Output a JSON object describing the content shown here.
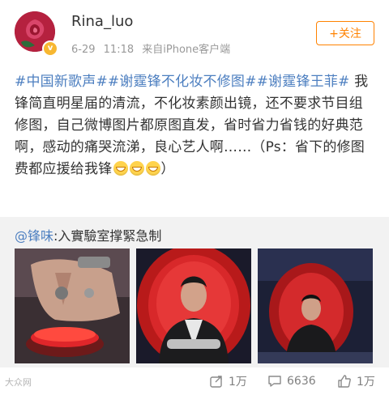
{
  "post": {
    "username": "Rina_luo",
    "date": "6-29",
    "time": "11:18",
    "source": "来自iPhone客户端",
    "follow_label": "+关注",
    "topics": [
      "#中国新歌声#",
      "#谢霆锋不化妆不修图#",
      "#谢霆锋王菲#"
    ],
    "text": "我锋简直明星届的清流，不化妆素颜出镜，还不要求节目组修图，自己微博图片都原图直发，省时省力省钱的好典范啊，感动的痛哭流涕，良心艺人啊……（Ps：省下的修图费都应援给我锋",
    "text_end": "）",
    "emoji_count": 3
  },
  "retweet": {
    "author": "@锋味",
    "colon": ":",
    "text": "入實驗室撑緊急制"
  },
  "footer": {
    "watermark": "大众网",
    "shares": "1万",
    "comments": "6636",
    "likes": "1万"
  },
  "colors": {
    "link": "#4d7fc0",
    "accent": "#ff8200",
    "retweet_bg": "#f2f2f2"
  },
  "icons": {
    "share": "share-icon",
    "comment": "comment-icon",
    "like": "thumbs-up-icon"
  }
}
